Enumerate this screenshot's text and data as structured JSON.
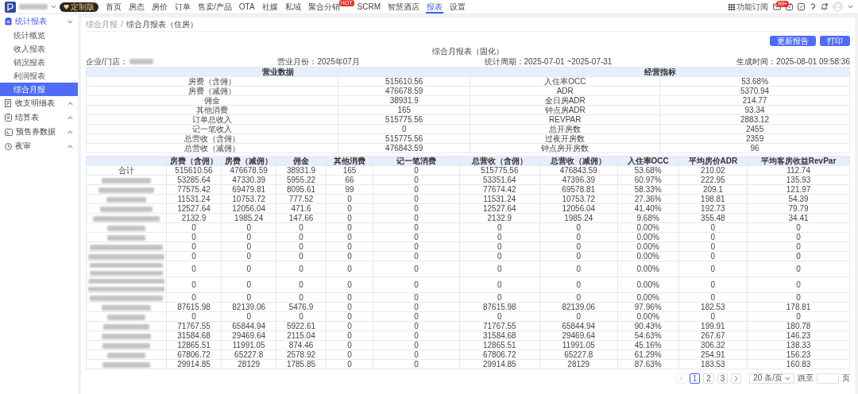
{
  "top_nav": {
    "brand_redacted": true,
    "edition_badge": "定制版",
    "items": [
      {
        "label": "首页",
        "selected": false
      },
      {
        "label": "房态",
        "selected": false
      },
      {
        "label": "房价",
        "selected": false
      },
      {
        "label": "订单",
        "selected": false
      },
      {
        "label": "售卖/产品",
        "selected": false
      },
      {
        "label": "OTA",
        "selected": false
      },
      {
        "label": "社媒",
        "selected": false
      },
      {
        "label": "私域",
        "selected": false
      },
      {
        "label": "聚合分销",
        "selected": false,
        "badge": "HOT"
      },
      {
        "label": "SCRM",
        "selected": false
      },
      {
        "label": "智慧酒店",
        "selected": false
      },
      {
        "label": "报表",
        "selected": true
      },
      {
        "label": "设置",
        "selected": false
      }
    ],
    "subscribe": "功能订阅",
    "mail_badge": "99+",
    "bell_dot": true
  },
  "sidebar": {
    "groups": [
      {
        "label": "统计报表",
        "expanded": true,
        "children": [
          {
            "label": "统计概览",
            "selected": false
          },
          {
            "label": "收入报表",
            "selected": false
          },
          {
            "label": "销况报表",
            "selected": false
          },
          {
            "label": "利润报表",
            "selected": false
          },
          {
            "label": "综合月报",
            "selected": true
          }
        ]
      },
      {
        "label": "收支明细表",
        "expanded": false
      },
      {
        "label": "结算表",
        "expanded": false
      },
      {
        "label": "预售券数据",
        "expanded": false
      },
      {
        "label": "夜审",
        "expanded": false
      }
    ]
  },
  "breadcrumb": [
    "综合月报",
    "综合月报表（住房）"
  ],
  "breadcrumb_separator": "/",
  "buttons": [
    "更新报告",
    "打印"
  ],
  "report_title": "综合月报表（固化）",
  "meta": [
    {
      "text": "企业/门店：",
      "redacted": true
    },
    {
      "text": "营业月份：2025年07月"
    },
    {
      "text": "统计周期：2025-07-01 ~2025-07-31"
    },
    {
      "text": "生成时间：2025-08-01 09:58:36"
    }
  ],
  "summary": {
    "headers": [
      "营业数据",
      "经营指标"
    ],
    "rows": [
      [
        "房费（含佣）",
        "515610.56",
        "入住率OCC",
        "53.68%"
      ],
      [
        "房费（减佣）",
        "476678.59",
        "ADR",
        "5370.94"
      ],
      [
        "佣金",
        "38931.9",
        "全日房ADR",
        "214.77"
      ],
      [
        "其他消费",
        "165",
        "钟点房ADR",
        "93.34"
      ],
      [
        "订单总收入",
        "515775.56",
        "REVPAR",
        "2883.12"
      ],
      [
        "记一笔收入",
        "0",
        "总开房数",
        "2455"
      ],
      [
        "总营收（含佣）",
        "515775.56",
        "过夜开房数",
        "2359"
      ],
      [
        "总营收（减佣）",
        "476843.59",
        "钟点房开房数",
        "96"
      ]
    ]
  },
  "table": {
    "columns": [
      "房费（含佣）",
      "房费（减佣）",
      "佣金",
      "其他消费",
      "记一笔消费",
      "总营收（含佣）",
      "总营收（减佣）",
      "入住率OCC",
      "平均房价ADR",
      "平均客房收益RevPar"
    ],
    "rows": [
      {
        "kind": "total",
        "label": "合计",
        "cells": [
          "515610.56",
          "476678.59",
          "38931.9",
          "165",
          "0",
          "515775.56",
          "476843.59",
          "53.68%",
          "210.02",
          "112.74"
        ]
      },
      {
        "kind": "store",
        "cells": [
          "53285.64",
          "47330.39",
          "5955.22",
          "66",
          "0",
          "53351.64",
          "47396.39",
          "60.97%",
          "222.95",
          "135.93"
        ]
      },
      {
        "kind": "store",
        "cells": [
          "77575.42",
          "69479.81",
          "8095.61",
          "99",
          "0",
          "77674.42",
          "69578.81",
          "58.33%",
          "209.1",
          "121.97"
        ]
      },
      {
        "kind": "store",
        "cells": [
          "11531.24",
          "10753.72",
          "777.52",
          "0",
          "0",
          "11531.24",
          "10753.72",
          "27.36%",
          "198.81",
          "54.39"
        ]
      },
      {
        "kind": "store",
        "cells": [
          "12527.64",
          "12056.04",
          "471.6",
          "0",
          "0",
          "12527.64",
          "12056.04",
          "41.40%",
          "192.73",
          "79.79"
        ]
      },
      {
        "kind": "store",
        "cells": [
          "2132.9",
          "1985.24",
          "147.66",
          "0",
          "0",
          "2132.9",
          "1985.24",
          "9.68%",
          "355.48",
          "34.41"
        ]
      },
      {
        "kind": "store",
        "cells": [
          "0",
          "0",
          "0",
          "0",
          "0",
          "0",
          "0",
          "0.00%",
          "0",
          "0"
        ]
      },
      {
        "kind": "store",
        "cells": [
          "0",
          "0",
          "0",
          "0",
          "0",
          "0",
          "0",
          "0.00%",
          "0",
          "0"
        ]
      },
      {
        "kind": "store",
        "cells": [
          "0",
          "0",
          "0",
          "0",
          "0",
          "0",
          "0",
          "0.00%",
          "0",
          "0"
        ]
      },
      {
        "kind": "store",
        "cells": [
          "0",
          "0",
          "0",
          "0",
          "0",
          "0",
          "0",
          "0.00%",
          "0",
          "0"
        ]
      },
      {
        "kind": "store-long",
        "cells": [
          "0",
          "0",
          "0",
          "0",
          "0",
          "0",
          "0",
          "0.00%",
          "0",
          "0"
        ]
      },
      {
        "kind": "store-long",
        "cells": [
          "0",
          "0",
          "0",
          "0",
          "0",
          "0",
          "0",
          "0.00%",
          "0",
          "0"
        ]
      },
      {
        "kind": "store",
        "cells": [
          "0",
          "0",
          "0",
          "0",
          "0",
          "0",
          "0",
          "0.00%",
          "0",
          "0"
        ]
      },
      {
        "kind": "store",
        "cells": [
          "87615.98",
          "82139.06",
          "5476.9",
          "0",
          "0",
          "87615.98",
          "82139.06",
          "97.96%",
          "182.53",
          "178.81"
        ]
      },
      {
        "kind": "store",
        "cells": [
          "0",
          "0",
          "0",
          "0",
          "0",
          "0",
          "0",
          "0.00%",
          "0",
          "0"
        ]
      },
      {
        "kind": "store",
        "cells": [
          "71767.55",
          "65844.94",
          "5922.61",
          "0",
          "0",
          "71767.55",
          "65844.94",
          "90.43%",
          "199.91",
          "180.78"
        ]
      },
      {
        "kind": "store",
        "cells": [
          "31584.68",
          "29469.64",
          "2115.04",
          "0",
          "0",
          "31584.68",
          "29469.64",
          "54.63%",
          "267.67",
          "146.23"
        ]
      },
      {
        "kind": "store",
        "cells": [
          "12865.51",
          "11991.05",
          "874.46",
          "0",
          "0",
          "12865.51",
          "11991.05",
          "45.16%",
          "306.32",
          "138.33"
        ]
      },
      {
        "kind": "store",
        "cells": [
          "67806.72",
          "65227.8",
          "2578.92",
          "0",
          "0",
          "67806.72",
          "65227.8",
          "61.29%",
          "254.91",
          "156.23"
        ]
      },
      {
        "kind": "store",
        "cells": [
          "29914.85",
          "28129",
          "1785.85",
          "0",
          "0",
          "29914.85",
          "28129",
          "87.63%",
          "183.53",
          "160.83"
        ]
      }
    ]
  },
  "pagination": {
    "prev_disabled": true,
    "next_disabled": false,
    "pages": [
      {
        "label": "1",
        "selected": true
      },
      {
        "label": "2",
        "selected": false
      },
      {
        "label": "3",
        "selected": false
      }
    ],
    "page_size": "20 条/页",
    "jump_label": "跳至",
    "page_unit": "页"
  }
}
